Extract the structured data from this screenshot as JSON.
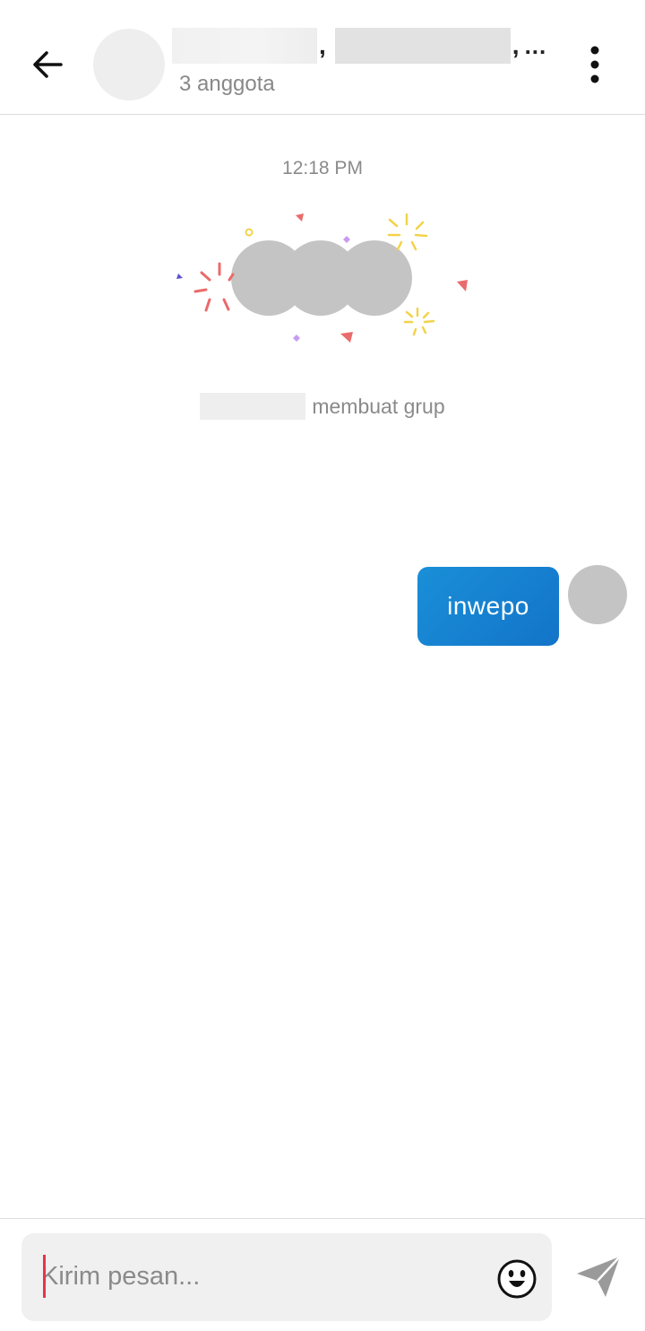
{
  "header": {
    "title_separator": ",",
    "title_overflow": "...",
    "member_count": "3 anggota",
    "icons": {
      "back": "arrow-left-icon",
      "more": "more-vertical-icon"
    }
  },
  "conversation": {
    "timestamp": "12:18 PM",
    "system_message": "membuat grup",
    "messages": [
      {
        "text": "inwepo",
        "outgoing": true
      }
    ]
  },
  "composer": {
    "placeholder": "Kirim pesan...",
    "value": "",
    "icons": {
      "emoji": "emoji-icon",
      "send": "send-icon"
    }
  },
  "colors": {
    "bubble": "#1a8fd8",
    "caret": "#e8334a",
    "muted_text": "#8a8a8a",
    "avatar_placeholder": "#c4c4c4"
  }
}
